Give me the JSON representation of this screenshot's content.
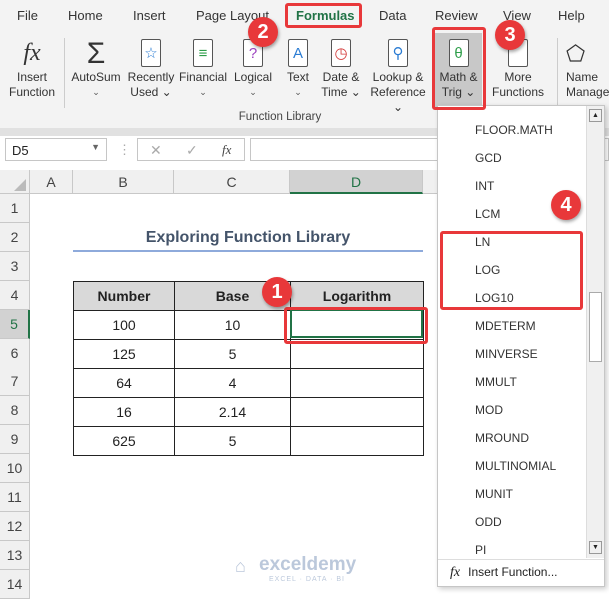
{
  "tabs": [
    "File",
    "Home",
    "Insert",
    "Page Layout",
    "Formulas",
    "Data",
    "Review",
    "View",
    "Help"
  ],
  "ribbon": {
    "buttons": [
      {
        "l1": "Insert",
        "l2": "Function"
      },
      {
        "l1": "AutoSum",
        "l2": "⌄"
      },
      {
        "l1": "Recently",
        "l2": "Used ⌄"
      },
      {
        "l1": "Financial",
        "l2": "⌄"
      },
      {
        "l1": "Logical",
        "l2": "⌄"
      },
      {
        "l1": "Text",
        "l2": "⌄"
      },
      {
        "l1": "Date &",
        "l2": "Time ⌄"
      },
      {
        "l1": "Lookup &",
        "l2": "Reference ⌄"
      },
      {
        "l1": "Math &",
        "l2": "Trig ⌄"
      },
      {
        "l1": "More",
        "l2": "Functions ⌄"
      },
      {
        "l1": "Name",
        "l2": "Manager"
      }
    ],
    "group_label": "Function Library"
  },
  "formula_bar": {
    "name_box": "D5",
    "fx": "fx",
    "value": ""
  },
  "columns": [
    "A",
    "B",
    "C",
    "D"
  ],
  "rows": [
    "1",
    "2",
    "3",
    "4",
    "5",
    "6",
    "7",
    "8",
    "9",
    "10",
    "11",
    "12",
    "13",
    "14"
  ],
  "sheet": {
    "title": "Exploring Function Library",
    "headers": [
      "Number",
      "Base",
      "Logarithm"
    ],
    "data": [
      [
        "100",
        "10",
        ""
      ],
      [
        "125",
        "5",
        ""
      ],
      [
        "64",
        "4",
        ""
      ],
      [
        "16",
        "2.14",
        ""
      ],
      [
        "625",
        "5",
        ""
      ]
    ]
  },
  "dropdown": {
    "items": [
      "FLOOR.MATH",
      "GCD",
      "INT",
      "LCM",
      "LN",
      "LOG",
      "LOG10",
      "MDETERM",
      "MINVERSE",
      "MMULT",
      "MOD",
      "MROUND",
      "MULTINOMIAL",
      "MUNIT",
      "ODD",
      "PI"
    ],
    "insert_function": "Insert Function..."
  },
  "badges": [
    "1",
    "2",
    "3",
    "4"
  ],
  "watermark": {
    "name": "exceldemy",
    "tagline": "EXCEL · DATA · BI"
  },
  "colors": {
    "highlight": "#e8383a",
    "excel_green": "#217346",
    "title_underline": "#8eaadb"
  }
}
